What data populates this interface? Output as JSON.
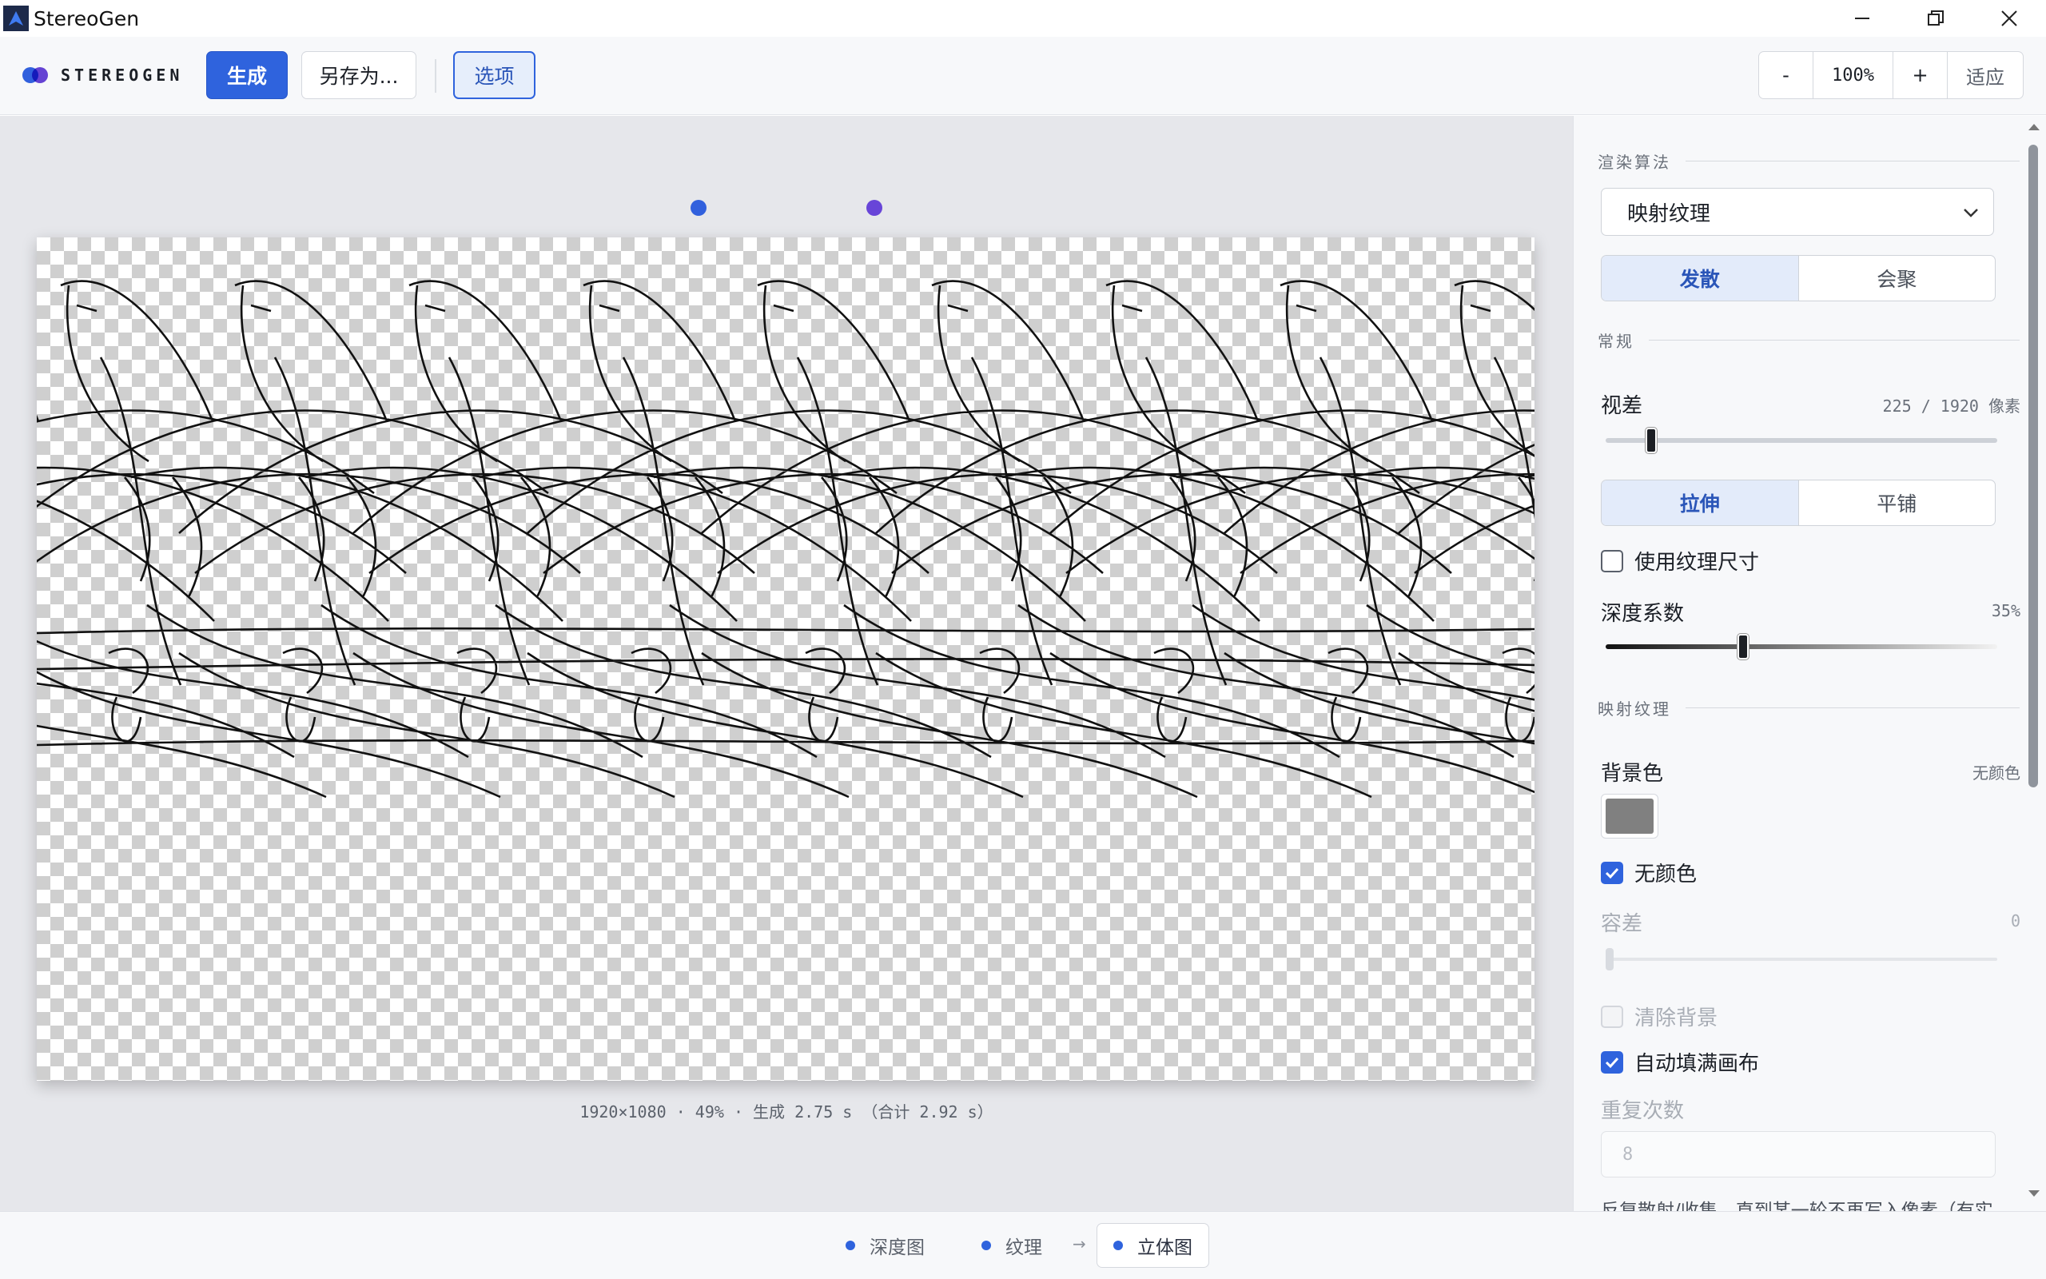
{
  "window": {
    "title": "StereoGen",
    "controls": {
      "minimize": "minimize-icon",
      "maximize": "restore-icon",
      "close": "close-icon"
    }
  },
  "toolbar": {
    "brand": "STEREOGEN",
    "generate_label": "生成",
    "saveas_label": "另存为...",
    "options_label": "选项",
    "zoom": {
      "minus": "-",
      "value": "100%",
      "plus": "+",
      "fit": "适应"
    }
  },
  "canvas": {
    "status": "1920×1080 · 49% · 生成 2.75 s （合计 2.92 s）",
    "eye_dot_colors": [
      "#3160dd",
      "#6845d8"
    ]
  },
  "panel": {
    "render_section": "渲染算法",
    "algorithm_value": "映射纹理",
    "mode": {
      "options": [
        "发散",
        "会聚"
      ],
      "selected": "发散"
    },
    "general_section": "常规",
    "parallax": {
      "label": "视差",
      "value": "225 / 1920 像素",
      "fraction": 0.117
    },
    "fit_mode": {
      "options": [
        "拉伸",
        "平铺"
      ],
      "selected": "拉伸"
    },
    "use_texture_size": {
      "label": "使用纹理尺寸",
      "checked": false
    },
    "depth": {
      "label": "深度系数",
      "value": "35%",
      "fraction": 0.35
    },
    "mapping_section": "映射纹理",
    "background": {
      "label": "背景色",
      "value": "无颜色",
      "color": "#808080"
    },
    "no_color": {
      "label": "无颜色",
      "checked": true
    },
    "tolerance": {
      "label": "容差",
      "value": "0",
      "fraction": 0
    },
    "clear_background": {
      "label": "清除背景",
      "checked": false,
      "disabled": true
    },
    "auto_fill": {
      "label": "自动填满画布",
      "checked": true
    },
    "repeat": {
      "label": "重复次数",
      "placeholder": "8"
    },
    "help": "反复散射/收集，直到某一轮不再写入像素（有实"
  },
  "steps": [
    {
      "label": "深度图",
      "active": false
    },
    {
      "label": "纹理",
      "active": false
    },
    {
      "label": "立体图",
      "active": true
    }
  ],
  "step_arrow": "→"
}
